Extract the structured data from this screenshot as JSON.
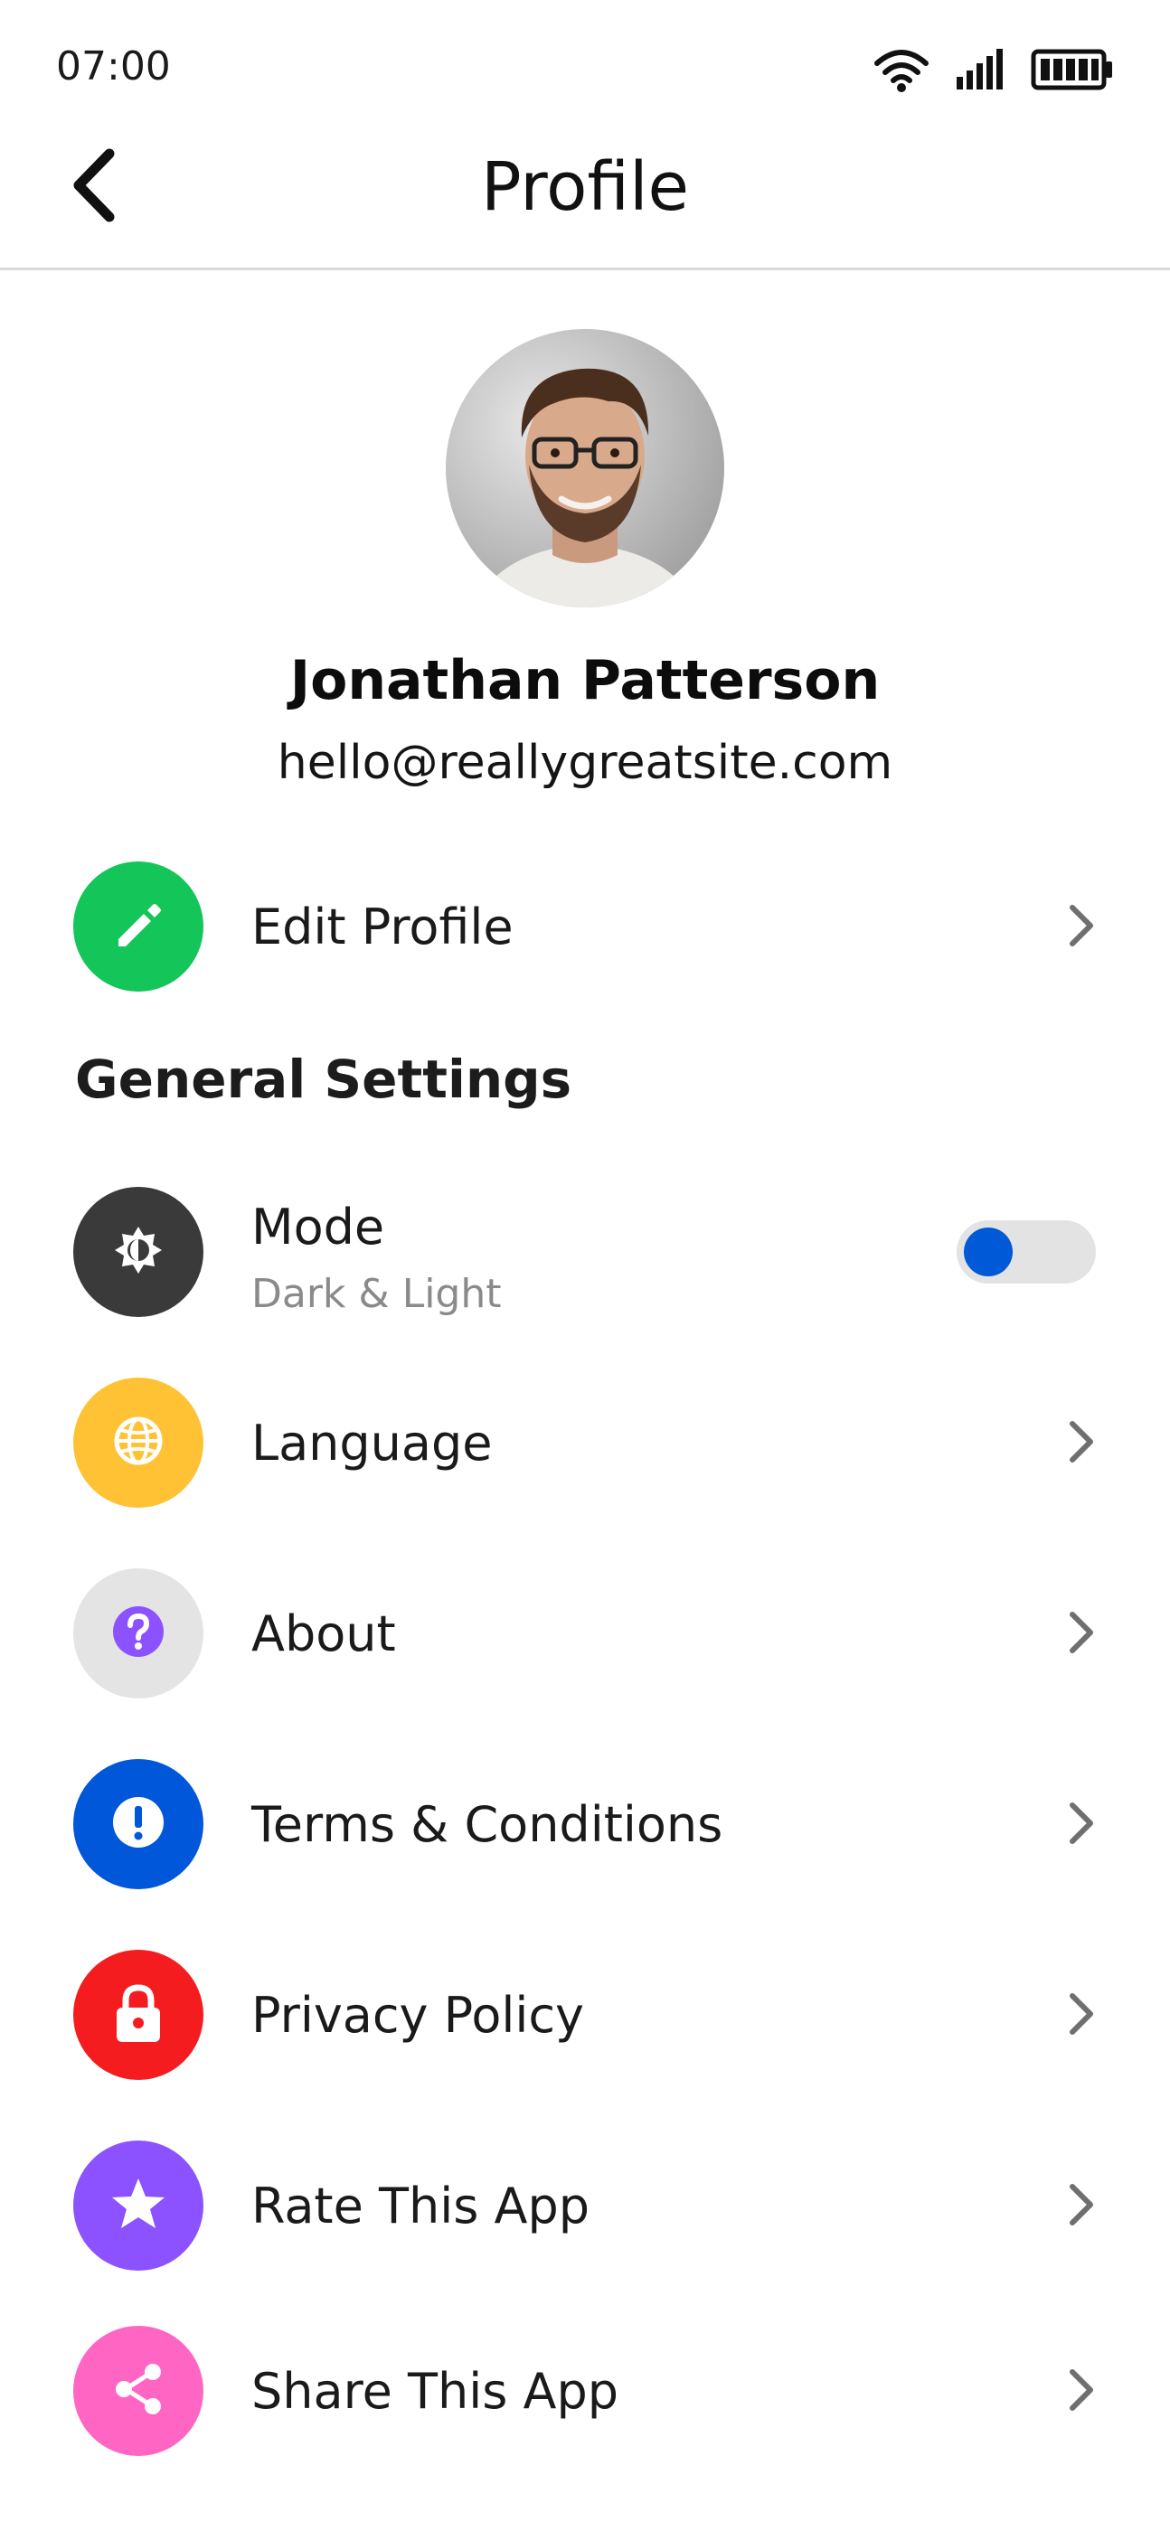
{
  "status_bar": {
    "time": "07:00",
    "icons": [
      "wifi-icon",
      "signal-icon",
      "battery-icon"
    ]
  },
  "header": {
    "title": "Profile",
    "back_icon": "chevron-left-icon"
  },
  "profile": {
    "name": "Jonathan Patterson",
    "email": "hello@reallygreatsite.com",
    "avatar": "user-photo"
  },
  "edit_profile": {
    "label": "Edit Profile",
    "icon": "pencil-icon",
    "icon_color": "#14c55a"
  },
  "general_settings": {
    "heading": "General Settings",
    "mode": {
      "label": "Mode",
      "sublabel": "Dark & Light",
      "icon": "brightness-icon",
      "icon_color": "#3a3a3a",
      "toggle_on": false,
      "toggle_knob_color": "#0059d6"
    },
    "items": [
      {
        "label": "Language",
        "icon": "globe-icon",
        "icon_color": "#ffc234"
      },
      {
        "label": "About",
        "icon": "question-icon",
        "icon_color": "#e4e4e4"
      },
      {
        "label": "Terms & Conditions",
        "icon": "exclamation-icon",
        "icon_color": "#0057d9"
      },
      {
        "label": "Privacy Policy",
        "icon": "lock-icon",
        "icon_color": "#f51c1f"
      },
      {
        "label": "Rate This App",
        "icon": "star-icon",
        "icon_color": "#8c52ff"
      },
      {
        "label": "Share This App",
        "icon": "share-icon",
        "icon_color": "#ff66c4"
      }
    ]
  },
  "colors": {
    "chevron": "#6f6f6f",
    "divider": "#d9d9d9"
  }
}
